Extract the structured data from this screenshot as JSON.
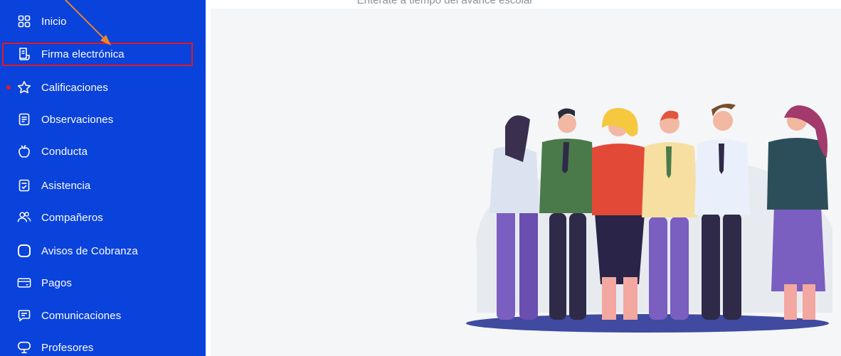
{
  "sidebar": {
    "items": [
      {
        "label": "Inicio",
        "icon": "grid-icon"
      },
      {
        "label": "Firma electrónica",
        "icon": "document-sign-icon"
      },
      {
        "label": "Calificaciones",
        "icon": "star-icon"
      },
      {
        "label": "Observaciones",
        "icon": "note-icon"
      },
      {
        "label": "Conducta",
        "icon": "apple-icon"
      },
      {
        "label": "Asistencia",
        "icon": "checklist-icon"
      },
      {
        "label": "Compañeros",
        "icon": "people-icon"
      },
      {
        "label": "Avisos de Cobranza",
        "icon": "rounded-square-icon"
      },
      {
        "label": "Pagos",
        "icon": "card-icon"
      },
      {
        "label": "Comunicaciones",
        "icon": "message-icon"
      },
      {
        "label": "Profesores",
        "icon": "chalkboard-icon"
      }
    ]
  },
  "main": {
    "subtitle": "Entérate a tiempo del avance escolar"
  },
  "colors": {
    "sidebar": "#0a42dc",
    "highlight": "#e21b1b",
    "annotation_arrow": "#e8852f"
  }
}
